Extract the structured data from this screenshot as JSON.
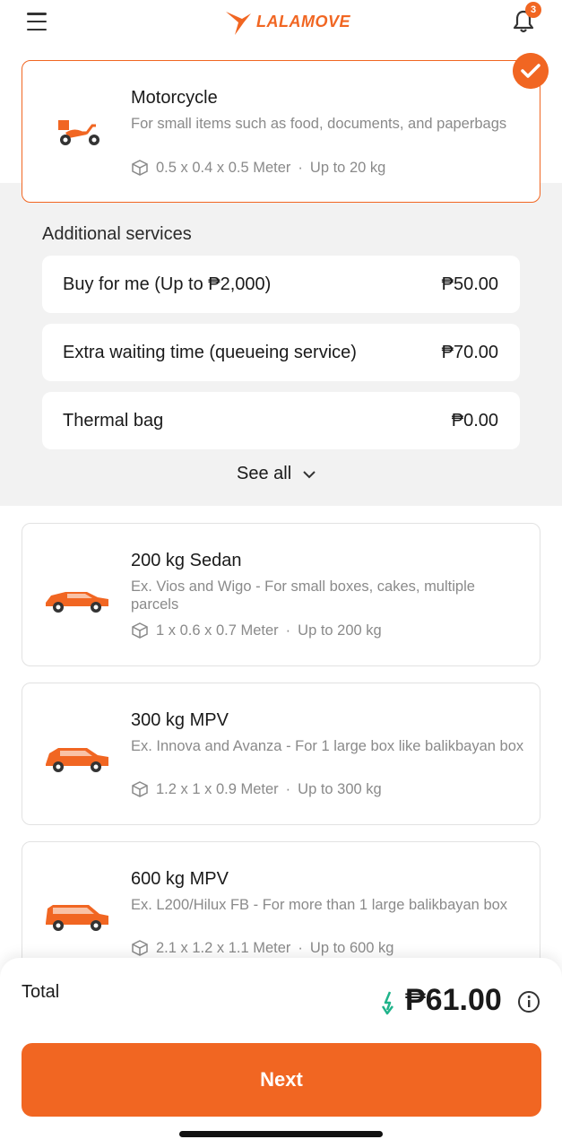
{
  "header": {
    "brand": "LALAMOVE",
    "notification_count": "3"
  },
  "colors": {
    "brand_orange": "#f16622",
    "price_drop_green": "#1fb38a"
  },
  "selected_vehicle": {
    "name": "Motorcycle",
    "description": "For small items such as food, documents, and paperbags",
    "dimensions": "0.5 x 0.4 x 0.5 Meter",
    "capacity": "Up to 20 kg",
    "icon": "motorcycle-icon"
  },
  "additional_services": {
    "title": "Additional services",
    "items": [
      {
        "label": "Buy for me (Up to ₱2,000)",
        "price": "₱50.00"
      },
      {
        "label": "Extra waiting time (queueing service)",
        "price": "₱70.00"
      },
      {
        "label": "Thermal bag",
        "price": "₱0.00"
      }
    ],
    "see_all": "See all"
  },
  "vehicles": [
    {
      "name": "200 kg Sedan",
      "description": "Ex. Vios and Wigo - For small boxes, cakes, multiple parcels",
      "dimensions": "1 x 0.6 x 0.7 Meter",
      "capacity": "Up to 200 kg",
      "icon": "sedan-icon"
    },
    {
      "name": "300 kg MPV",
      "description": "Ex. Innova and Avanza - For 1 large box like balikbayan box",
      "dimensions": "1.2 x 1 x 0.9 Meter",
      "capacity": "Up to 300 kg",
      "icon": "mpv-icon"
    },
    {
      "name": "600 kg MPV",
      "description": "Ex. L200/Hilux FB - For more than 1 large balikbayan box",
      "dimensions": "2.1 x 1.2 x 1.1 Meter",
      "capacity": "Up to 600 kg",
      "icon": "large-mpv-icon"
    }
  ],
  "footer": {
    "total_label": "Total",
    "total_amount": "₱61.00",
    "next_label": "Next"
  },
  "spec_separator": "·"
}
